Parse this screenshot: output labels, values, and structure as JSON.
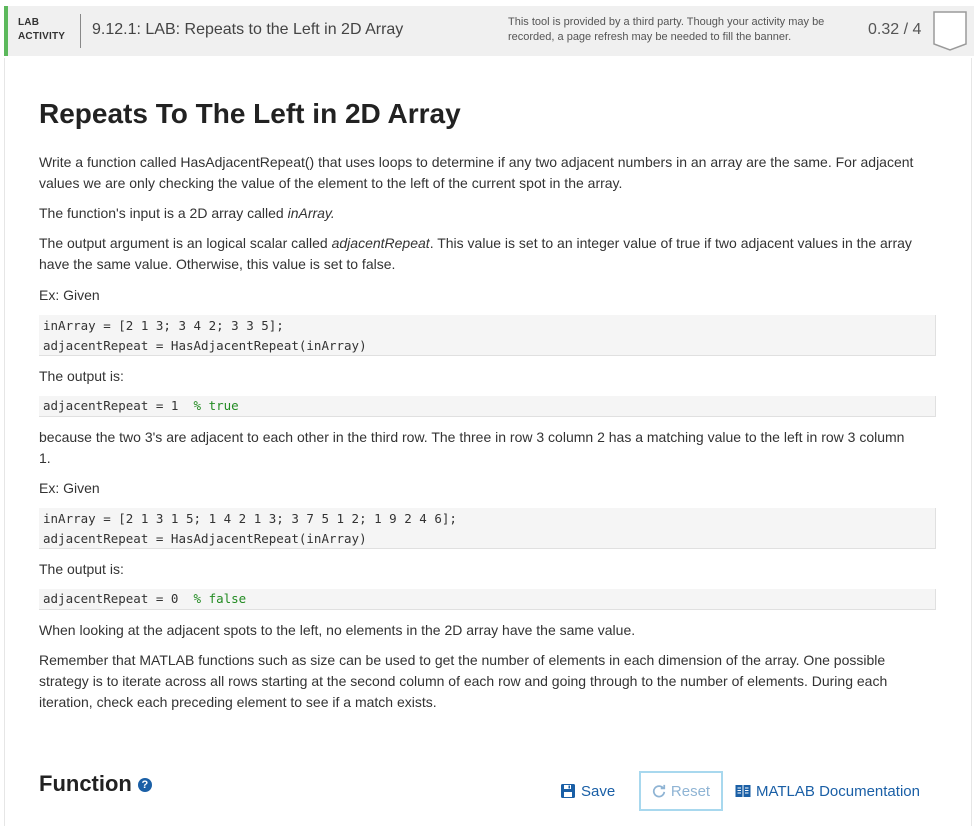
{
  "header": {
    "lab_tag_line1": "LAB",
    "lab_tag_line2": "ACTIVITY",
    "title": "9.12.1: LAB: Repeats to the Left in 2D Array",
    "notice": "This tool is provided by a third party. Though your activity may be recorded, a page refresh may be needed to fill the banner.",
    "score": "0.32 / 4",
    "accent_color": "#5cb85c"
  },
  "content": {
    "title": "Repeats To The Left in 2D Array",
    "p1": "Write a function called HasAdjacentRepeat() that uses loops to determine if any two adjacent numbers in an array are the same. For adjacent values we are only checking the value of the element to the left of the current spot in the array.",
    "p2_prefix": "The function's input is a 2D array called ",
    "p2_var": "inArray.",
    "p3_prefix": "The output argument is an logical scalar called ",
    "p3_var": "adjacentRepeat",
    "p3_suffix": ". This value is set to an integer value of true if two adjacent values in the array have the same value. Otherwise, this value is set to false.",
    "ex1_label": "Ex: Given",
    "ex1_code_line1": "inArray = [2 1 3; 3 4 2; 3 3 5];",
    "ex1_code_line2": "adjacentRepeat = HasAdjacentRepeat(inArray)",
    "output_label_1": "The output is:",
    "ex1_output_code": "adjacentRepeat = 1  ",
    "ex1_output_comment": "% true",
    "p4": "because the two 3's are adjacent to each other in the third row. The three in row 3 column 2 has a matching value to the left in row 3 column 1.",
    "ex2_label": "Ex: Given",
    "ex2_code_line1": "inArray = [2 1 3 1 5; 1 4 2 1 3; 3 7 5 1 2; 1 9 2 4 6];",
    "ex2_code_line2": "adjacentRepeat = HasAdjacentRepeat(inArray)",
    "output_label_2": "The output is:",
    "ex2_output_code": "adjacentRepeat = 0  ",
    "ex2_output_comment": "% false",
    "p5": "When looking at the adjacent spots to the left, no elements in the 2D array have the same value.",
    "p6": "Remember that MATLAB functions such as size can be used to get the number of elements in each dimension of the array. One possible strategy is to iterate across all rows starting at the second column of each row and going through to the number of elements. During each iteration, check each preceding element to see if a match exists."
  },
  "function_section": {
    "title": "Function",
    "help_icon": "question-circle-icon",
    "save_label": "Save",
    "reset_label": "Reset",
    "docs_label": "MATLAB Documentation"
  }
}
